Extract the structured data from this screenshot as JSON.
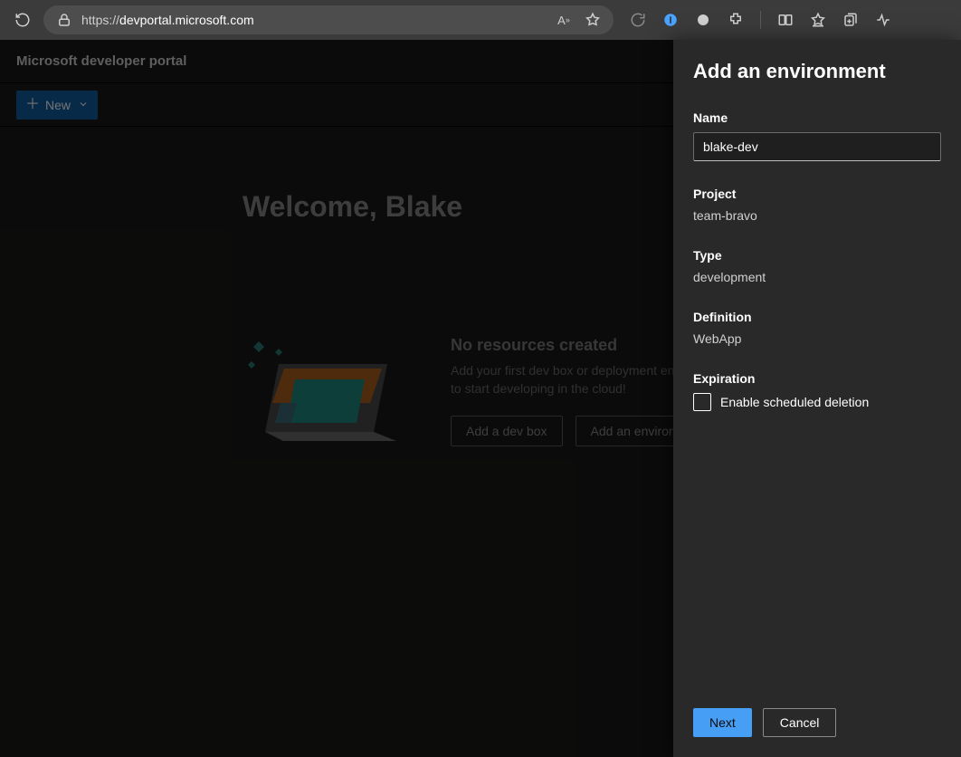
{
  "browser": {
    "url_prefix": "https://",
    "url_domain": "devportal.microsoft.com"
  },
  "app": {
    "title": "Microsoft developer portal",
    "new_button": "New"
  },
  "main": {
    "welcome": "Welcome, Blake",
    "empty_heading": "No resources created",
    "empty_body": "Add your first dev box or deployment environment to start developing in the cloud!",
    "add_devbox": "Add a dev box",
    "add_env": "Add an environment"
  },
  "panel": {
    "title": "Add an environment",
    "name_label": "Name",
    "name_value": "blake-dev",
    "project_label": "Project",
    "project_value": "team-bravo",
    "type_label": "Type",
    "type_value": "development",
    "definition_label": "Definition",
    "definition_value": "WebApp",
    "expiration_label": "Expiration",
    "checkbox_label": "Enable scheduled deletion",
    "next": "Next",
    "cancel": "Cancel"
  }
}
